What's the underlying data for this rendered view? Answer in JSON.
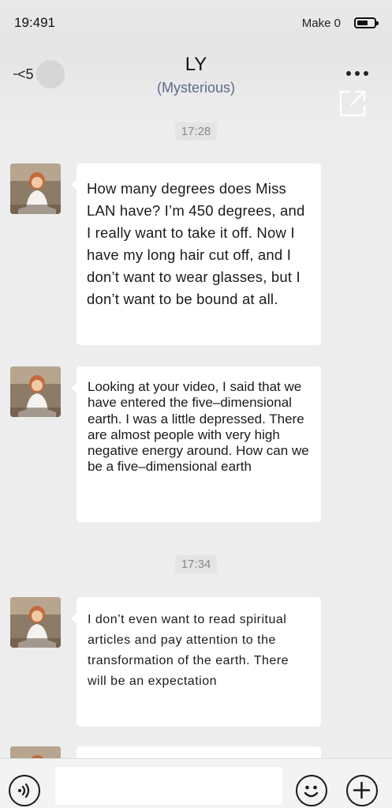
{
  "status_bar": {
    "time": "19:491",
    "carrier": "Make 0"
  },
  "header": {
    "back_label": "<5",
    "title": "LY",
    "subtitle": "(Mysterious)"
  },
  "messages": [
    {
      "type": "timestamp",
      "text": "17:28"
    },
    {
      "type": "message",
      "sender": "LY",
      "avatar_icon": "girl-avatar",
      "text": "How many degrees does Miss LAN have? I’m 450 degrees, and I really want to take it off. Now I have my long hair cut off, and I don’t want to wear glasses, but I don’t want to be bound at all."
    },
    {
      "type": "message",
      "sender": "LY",
      "avatar_icon": "girl-avatar",
      "text": "Looking at your video, I said that we have entered the five–dimensional earth. I was a little depressed. There are almost people with very high negative energy around. How can we be a five–dimensional earth"
    },
    {
      "type": "timestamp",
      "text": "17:34"
    },
    {
      "type": "message",
      "sender": "LY",
      "avatar_icon": "girl-avatar",
      "text": "I don’t even want to read spiritual articles and pay attention to the transformation of the earth. There will be an expectation"
    }
  ],
  "input_bar": {
    "input_value": "",
    "voice_icon": "voice-icon",
    "emoji_icon": "emoji-icon",
    "plus_icon": "plus-icon"
  },
  "colors": {
    "background": "#ededed",
    "bubble": "#ffffff",
    "subtitle": "#5f6a8a"
  }
}
